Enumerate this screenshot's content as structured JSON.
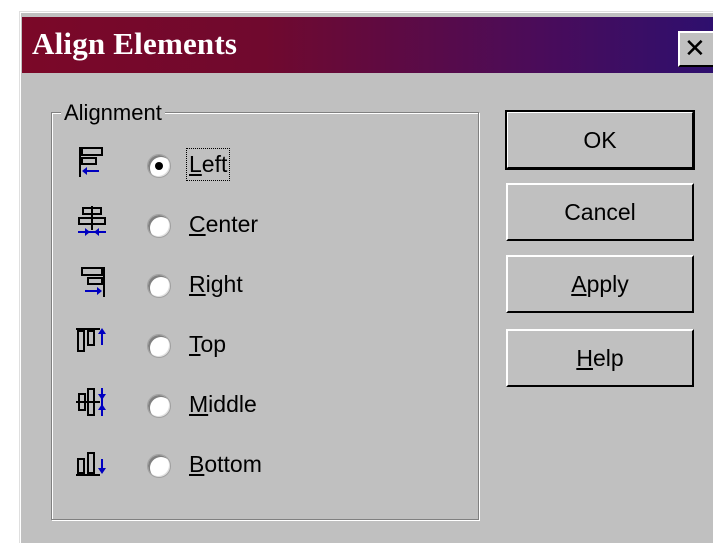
{
  "window": {
    "title": "Align Elements",
    "close_label": "✕"
  },
  "alignment_group": {
    "label": "Alignment",
    "selected": "Left",
    "options": [
      {
        "label": "Left",
        "mnemonic": "L",
        "icon": "align-left-icon"
      },
      {
        "label": "Center",
        "mnemonic": "C",
        "icon": "align-center-icon"
      },
      {
        "label": "Right",
        "mnemonic": "R",
        "icon": "align-right-icon"
      },
      {
        "label": "Top",
        "mnemonic": "T",
        "icon": "align-top-icon"
      },
      {
        "label": "Middle",
        "mnemonic": "M",
        "icon": "align-middle-icon"
      },
      {
        "label": "Bottom",
        "mnemonic": "B",
        "icon": "align-bottom-icon"
      }
    ]
  },
  "buttons": {
    "ok": "OK",
    "cancel": "Cancel",
    "apply": "Apply",
    "help": "Help"
  },
  "colors": {
    "title_bar_start": "#7b0828",
    "title_bar_end": "#2e0f6e",
    "face": "#c0c0c0",
    "icon_arrow": "#0000c0"
  }
}
